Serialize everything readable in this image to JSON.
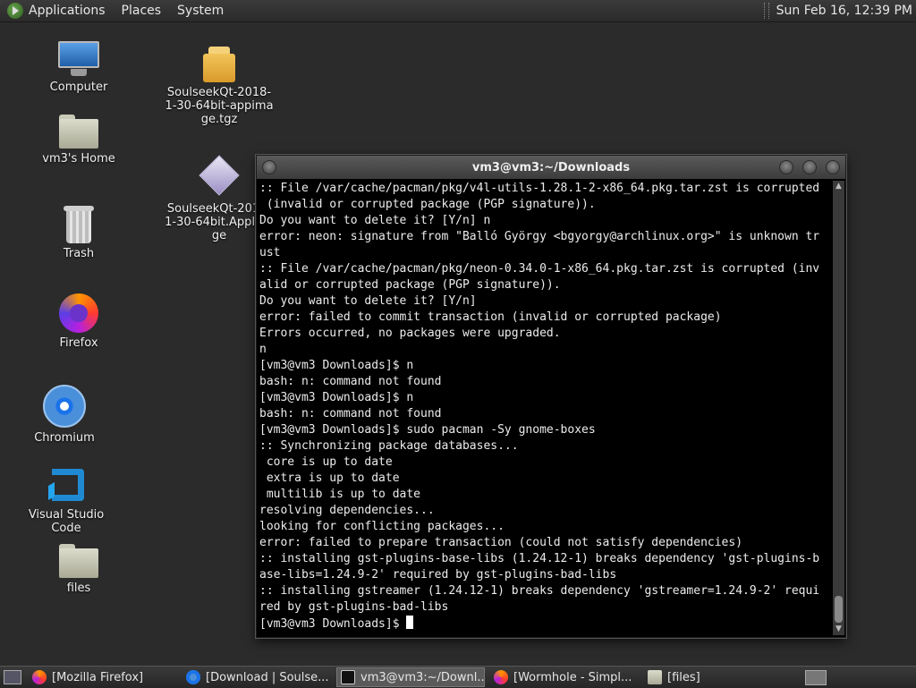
{
  "top_panel": {
    "menus": [
      "Applications",
      "Places",
      "System"
    ],
    "clock": "Sun Feb 16, 12:39 PM"
  },
  "desktop_icons": [
    {
      "label": "Computer",
      "icon": "computer-icon"
    },
    {
      "label": "vm3's Home",
      "icon": "home-folder-icon"
    },
    {
      "label": "Trash",
      "icon": "trash-icon"
    },
    {
      "label": "Firefox",
      "icon": "firefox-icon"
    },
    {
      "label": "Chromium",
      "icon": "chromium-icon"
    },
    {
      "label": "Visual Studio Code",
      "icon": "vscode-icon"
    },
    {
      "label": "files",
      "icon": "folder-icon"
    },
    {
      "label": "SoulseekQt-2018-1-30-64bit-appimage.tgz",
      "icon": "archive-icon"
    },
    {
      "label": "SoulseekQt-2018-1-30-64bit.AppImage",
      "icon": "appimage-icon"
    }
  ],
  "terminal": {
    "title": "vm3@vm3:~/Downloads",
    "lines": [
      ":: File /var/cache/pacman/pkg/v4l-utils-1.28.1-2-x86_64.pkg.tar.zst is corrupted",
      " (invalid or corrupted package (PGP signature)).",
      "Do you want to delete it? [Y/n] n",
      "error: neon: signature from \"Balló György <bgyorgy@archlinux.org>\" is unknown tr",
      "ust",
      ":: File /var/cache/pacman/pkg/neon-0.34.0-1-x86_64.pkg.tar.zst is corrupted (inv",
      "alid or corrupted package (PGP signature)).",
      "Do you want to delete it? [Y/n]",
      "error: failed to commit transaction (invalid or corrupted package)",
      "Errors occurred, no packages were upgraded.",
      "n",
      "[vm3@vm3 Downloads]$ n",
      "bash: n: command not found",
      "[vm3@vm3 Downloads]$ n",
      "bash: n: command not found",
      "[vm3@vm3 Downloads]$ sudo pacman -Sy gnome-boxes",
      ":: Synchronizing package databases...",
      " core is up to date",
      " extra is up to date",
      " multilib is up to date",
      "resolving dependencies...",
      "looking for conflicting packages...",
      "error: failed to prepare transaction (could not satisfy dependencies)",
      ":: installing gst-plugins-base-libs (1.24.12-1) breaks dependency 'gst-plugins-b",
      "ase-libs=1.24.9-2' required by gst-plugins-bad-libs",
      ":: installing gstreamer (1.24.12-1) breaks dependency 'gstreamer=1.24.9-2' requi",
      "red by gst-plugins-bad-libs"
    ],
    "prompt": "[vm3@vm3 Downloads]$ "
  },
  "taskbar": {
    "tasks": [
      {
        "label": "[Mozilla Firefox]",
        "icon": "firefox-icon",
        "active": false
      },
      {
        "label": "[Download | Soulse...",
        "icon": "chromium-icon",
        "active": false
      },
      {
        "label": "vm3@vm3:~/Downl...",
        "icon": "terminal-icon",
        "active": true
      },
      {
        "label": "[Wormhole - Simpl...",
        "icon": "firefox-icon",
        "active": false
      },
      {
        "label": "[files]",
        "icon": "folder-icon",
        "active": false
      }
    ]
  }
}
